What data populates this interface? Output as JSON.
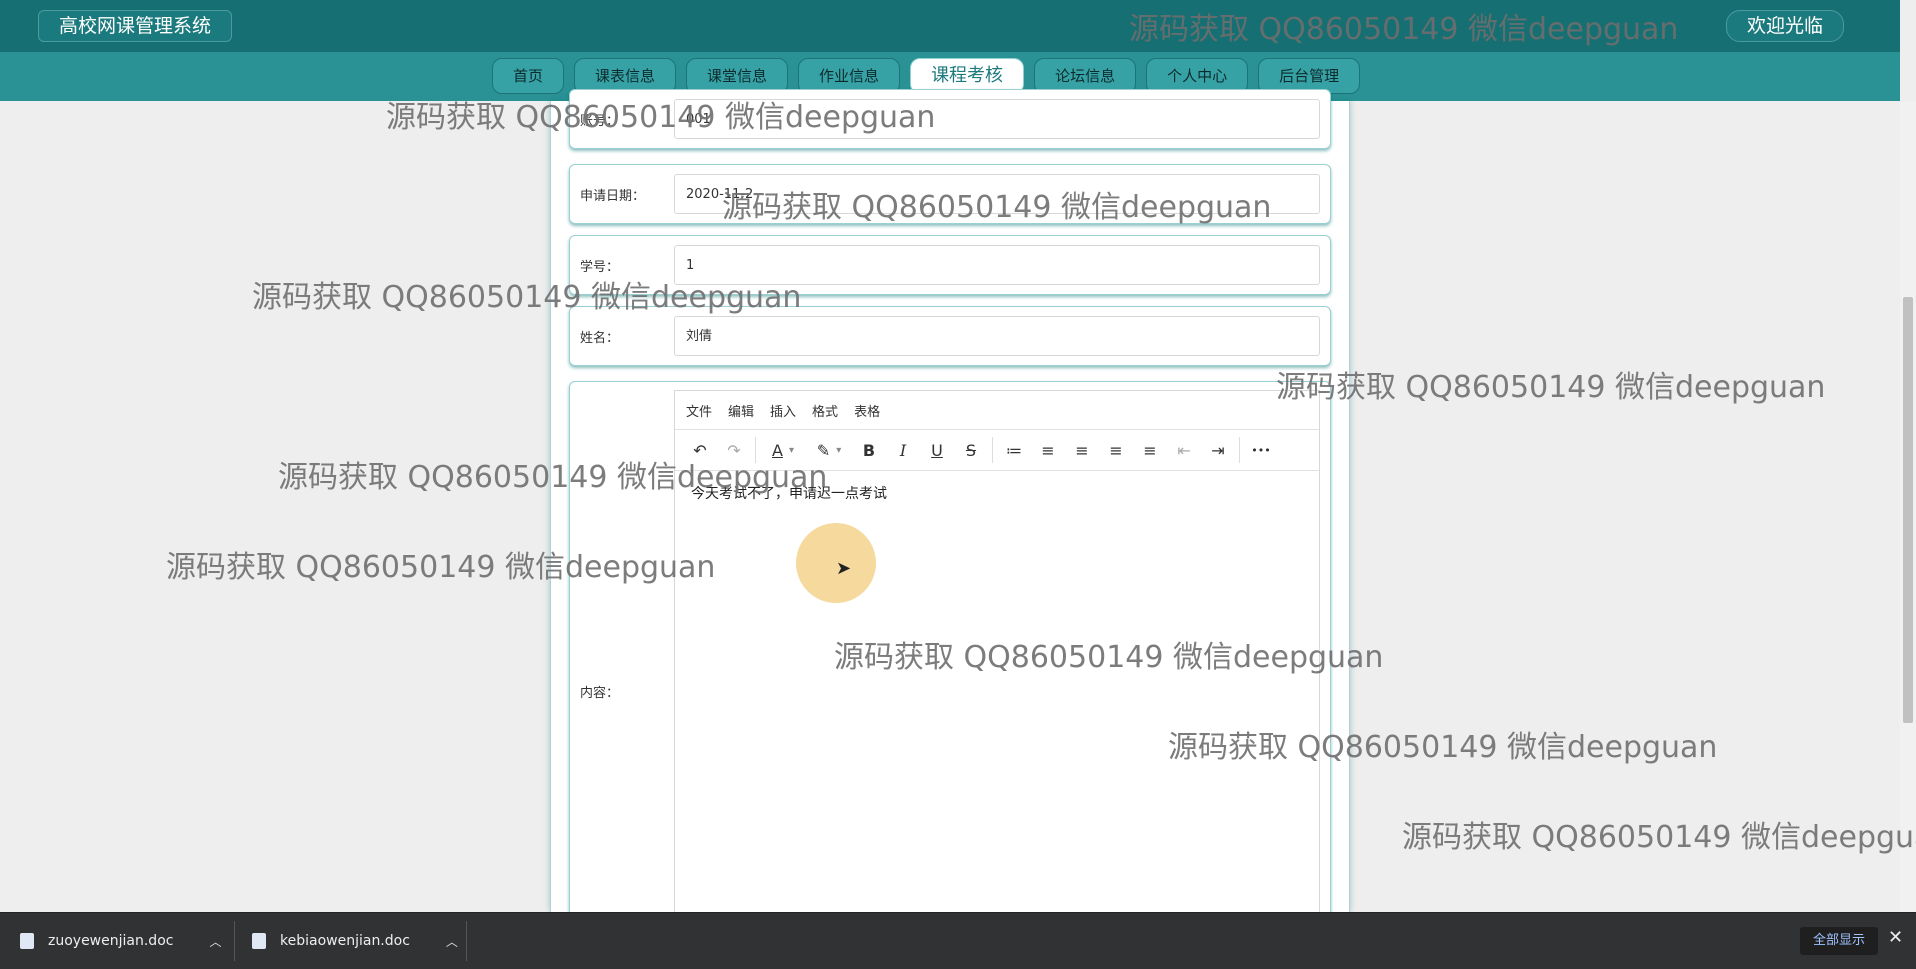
{
  "header": {
    "brand": "高校网课管理系统",
    "welcome": "欢迎光临"
  },
  "nav": [
    {
      "label": "首页",
      "active": false
    },
    {
      "label": "课表信息",
      "active": false
    },
    {
      "label": "课堂信息",
      "active": false
    },
    {
      "label": "作业信息",
      "active": false
    },
    {
      "label": "课程考核",
      "active": true
    },
    {
      "label": "论坛信息",
      "active": false
    },
    {
      "label": "个人中心",
      "active": false
    },
    {
      "label": "后台管理",
      "active": false
    }
  ],
  "form": {
    "account": {
      "label": "账号：",
      "value": "001"
    },
    "date": {
      "label": "申请日期：",
      "value": "2020-11-2"
    },
    "student_id": {
      "label": "学号：",
      "value": "1"
    },
    "name": {
      "label": "姓名：",
      "value": "刘倩"
    },
    "content": {
      "label": "内容：",
      "menus": [
        "文件",
        "编辑",
        "插入",
        "格式",
        "表格"
      ],
      "text": "今天考试不了，申请迟一点考试"
    }
  },
  "watermark": "源码获取 QQ86050149 微信deepguan",
  "downloads": {
    "files": [
      "zuoyewenjian.doc",
      "kebiaowenjian.doc"
    ],
    "show_all": "全部显示"
  },
  "colors": {
    "header": "#166f72",
    "navbar": "#2a9195",
    "nav_active_text": "#1d7a7d"
  },
  "icons": {
    "undo": "↶",
    "redo": "↷",
    "text_color": "A",
    "highlight": "✎",
    "bold": "B",
    "italic": "I",
    "underline": "U",
    "strike": "S",
    "list": "≔",
    "align_left": "≡",
    "align_center": "≡",
    "align_right": "≡",
    "justify": "≡",
    "outdent": "⇤",
    "indent": "⇥",
    "more": "•••",
    "cursor": "➤"
  }
}
